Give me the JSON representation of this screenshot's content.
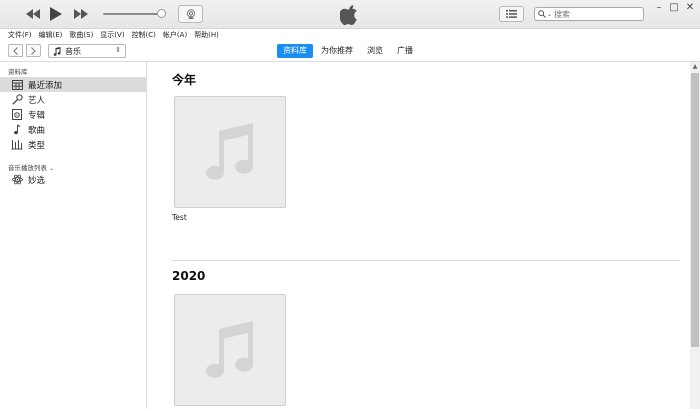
{
  "window": {
    "search_placeholder": "搜索",
    "minimize": "–",
    "maximize": "□",
    "close": "✕"
  },
  "player": {
    "volume_level": 0.9
  },
  "menu": [
    "文件(F)",
    "编辑(E)",
    "歌曲(S)",
    "显示(V)",
    "控制(C)",
    "帐户(A)",
    "帮助(H)"
  ],
  "nav": {
    "media_type": "音乐",
    "tabs": [
      {
        "label": "资料库",
        "active": true
      },
      {
        "label": "为你推荐",
        "active": false
      },
      {
        "label": "浏览",
        "active": false
      },
      {
        "label": "广播",
        "active": false
      }
    ]
  },
  "sidebar": {
    "library_header": "资料库",
    "items": [
      {
        "label": "最近添加",
        "icon": "recently-added-icon",
        "selected": true
      },
      {
        "label": "艺人",
        "icon": "microphone-icon",
        "selected": false
      },
      {
        "label": "专辑",
        "icon": "album-icon",
        "selected": false
      },
      {
        "label": "歌曲",
        "icon": "music-note-icon",
        "selected": false
      },
      {
        "label": "类型",
        "icon": "genre-icon",
        "selected": false
      }
    ],
    "playlists_header": "音乐播放列表",
    "playlists": [
      {
        "label": "妙选",
        "icon": "genius-atom-icon"
      }
    ]
  },
  "main": {
    "sections": [
      {
        "title": "今年",
        "albums": [
          {
            "title": "Test"
          }
        ]
      },
      {
        "title": "2020",
        "albums": [
          {
            "title": ""
          }
        ]
      }
    ]
  },
  "colors": {
    "accent": "#1a8ef0",
    "selected_row": "#dcdcdc",
    "artwork_placeholder": "#ececec"
  }
}
